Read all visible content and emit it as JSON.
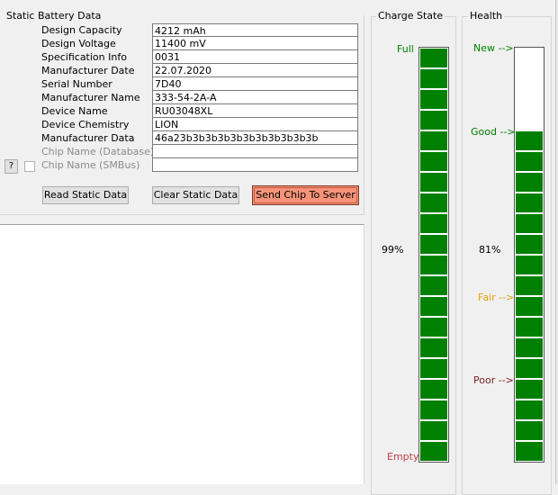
{
  "static": {
    "group_title": "Static Battery Data",
    "rows": [
      {
        "label": "Design Capacity",
        "value": "4212 mAh"
      },
      {
        "label": "Design Voltage",
        "value": "11400 mV"
      },
      {
        "label": "Specification Info",
        "value": "0031"
      },
      {
        "label": "Manufacturer Date",
        "value": "22.07.2020"
      },
      {
        "label": "Serial Number",
        "value": "7D40"
      },
      {
        "label": "Manufacturer Name",
        "value": "333-54-2A-A"
      },
      {
        "label": "Device Name",
        "value": "RU03048XL"
      },
      {
        "label": "Device Chemistry",
        "value": "LION"
      },
      {
        "label": "Manufacturer Data",
        "value": "46a23b3b3b3b3b3b3b3b3b3b3b"
      },
      {
        "label": "Chip Name (Database)",
        "value": ""
      },
      {
        "label": "Chip Name (SMBus)",
        "value": ""
      }
    ],
    "help_label": "?",
    "buttons": {
      "read": "Read Static Data",
      "clear": "Clear Static Data",
      "send": "Send Chip To Server"
    }
  },
  "charge": {
    "title": "Charge State",
    "label_full": "Full",
    "label_empty": "Empty",
    "percent_text": "99%",
    "level": 0.99,
    "color_full": "#008000",
    "color_empty": "#c04040"
  },
  "health": {
    "title": "Health",
    "label_new": "New -->",
    "label_good": "Good -->",
    "label_fair": "Fair -->",
    "label_poor": "Poor -->",
    "percent_text": "81%",
    "level": 0.81,
    "color_new": "#008000",
    "color_good": "#008000",
    "color_fair": "#e0a000",
    "color_poor": "#7a1f1f"
  },
  "colors": {
    "bar_fill": "#008000",
    "send_button": "#f8937a"
  }
}
